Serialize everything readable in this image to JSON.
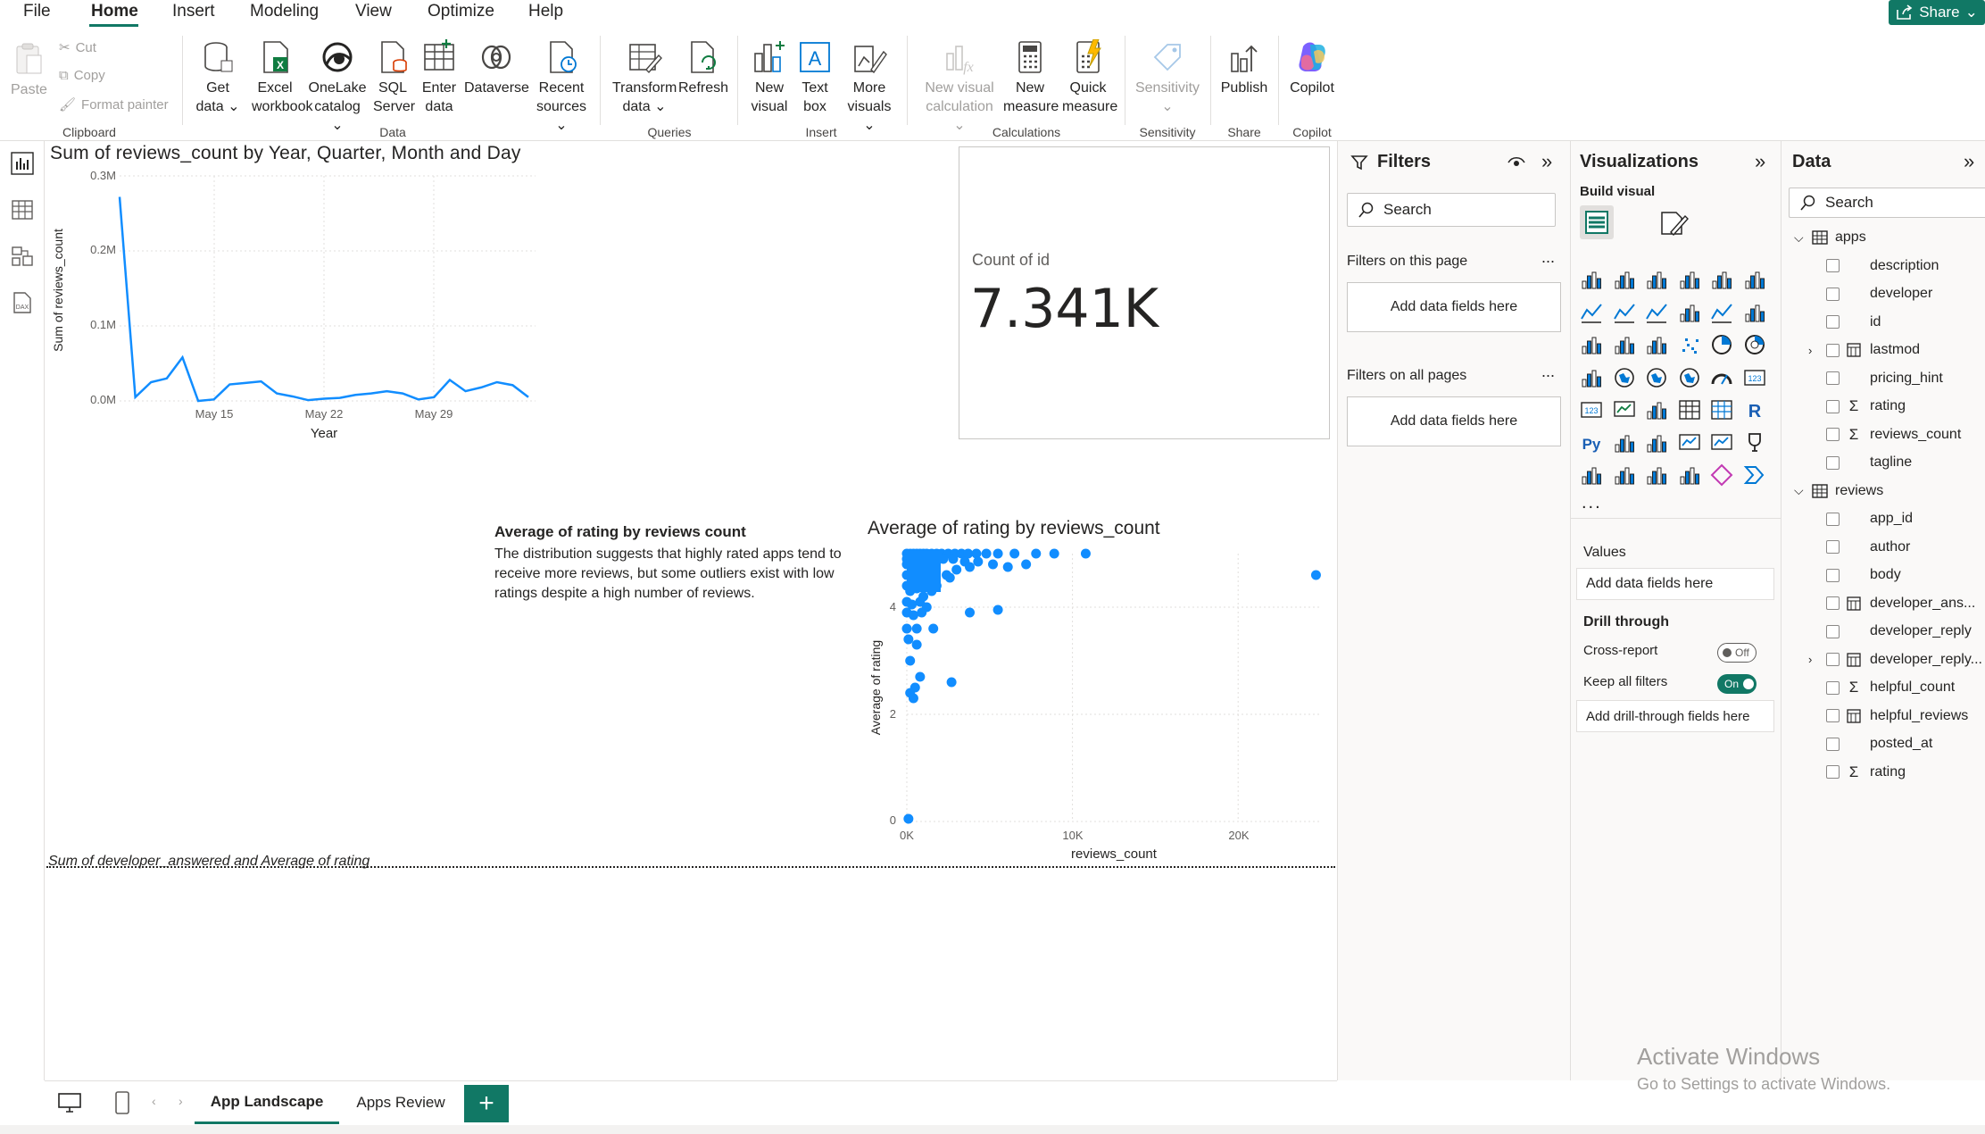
{
  "menu": {
    "items": [
      "File",
      "Home",
      "Insert",
      "Modeling",
      "View",
      "Optimize",
      "Help"
    ],
    "share_label": "Share"
  },
  "ribbon": {
    "clipboard": {
      "paste": "Paste",
      "cut": "Cut",
      "copy": "Copy",
      "format_painter": "Format painter",
      "group": "Clipboard"
    },
    "data": {
      "get_data": [
        "Get",
        "data ⌄"
      ],
      "excel": [
        "Excel",
        "workbook"
      ],
      "onelake": [
        "OneLake",
        "catalog ⌄"
      ],
      "sql": [
        "SQL",
        "Server"
      ],
      "enter": [
        "Enter",
        "data"
      ],
      "dataverse": [
        "Dataverse"
      ],
      "recent": [
        "Recent",
        "sources ⌄"
      ],
      "group": "Data"
    },
    "queries": {
      "transform": [
        "Transform",
        "data ⌄"
      ],
      "refresh": [
        "Refresh"
      ],
      "group": "Queries"
    },
    "insert": {
      "new_visual": [
        "New",
        "visual"
      ],
      "text_box": [
        "Text",
        "box"
      ],
      "more_visuals": [
        "More",
        "visuals ⌄"
      ],
      "group": "Insert"
    },
    "calculations": {
      "new_visual_calc": [
        "New visual",
        "calculation ⌄"
      ],
      "new_measure": [
        "New",
        "measure"
      ],
      "quick_measure": [
        "Quick",
        "measure"
      ],
      "group": "Calculations"
    },
    "sensitivity": {
      "label": [
        "Sensitivity",
        "⌄"
      ],
      "group": "Sensitivity"
    },
    "share": {
      "publish": [
        "Publish"
      ],
      "group": "Share"
    },
    "copilot": {
      "label": [
        "Copilot"
      ],
      "group": "Copilot"
    }
  },
  "line_chart": {
    "title": "Sum of reviews_count by Year, Quarter, Month and Day",
    "xlabel": "Year",
    "ylabel": "Sum of reviews_count",
    "yticks": [
      "0.3M",
      "0.2M",
      "0.1M",
      "0.0M"
    ],
    "xticks": [
      "May 15",
      "May 22",
      "May 29"
    ]
  },
  "card": {
    "label": "Count of id",
    "value": "7.341K"
  },
  "narrative": {
    "title": "Average of rating by reviews count",
    "body": "The distribution suggests that highly rated apps tend to receive more reviews, but some outliers exist with low ratings despite a high number of reviews."
  },
  "scatter_chart": {
    "title": "Average of rating by reviews_count",
    "xlabel": "reviews_count",
    "ylabel": "Average of rating",
    "yticks": [
      "4",
      "2",
      "0"
    ],
    "xticks": [
      "0K",
      "10K",
      "20K"
    ]
  },
  "bottom_visual": {
    "title": "Sum of developer_answered and Average of rating"
  },
  "pages": {
    "tabs": [
      "App Landscape",
      "Apps Review"
    ],
    "add": "+"
  },
  "filters": {
    "title": "Filters",
    "search_placeholder": "Search",
    "this_page": "Filters on this page",
    "all_pages": "Filters on all pages",
    "add_fields": "Add data fields here",
    "more": "..."
  },
  "visualizations": {
    "title": "Visualizations",
    "build_visual": "Build visual",
    "more": "...",
    "values_label": "Values",
    "values_placeholder": "Add data fields here",
    "drill_through": "Drill through",
    "cross_report": "Cross-report",
    "cross_report_state": "Off",
    "keep_filters": "Keep all filters",
    "keep_filters_state": "On",
    "drill_placeholder": "Add drill-through fields here"
  },
  "data_pane": {
    "title": "Data",
    "search_placeholder": "Search",
    "tables": [
      {
        "name": "apps",
        "fields": [
          {
            "name": "description",
            "kind": "text"
          },
          {
            "name": "developer",
            "kind": "text"
          },
          {
            "name": "id",
            "kind": "text"
          },
          {
            "name": "lastmod",
            "kind": "date"
          },
          {
            "name": "pricing_hint",
            "kind": "text"
          },
          {
            "name": "rating",
            "kind": "sum"
          },
          {
            "name": "reviews_count",
            "kind": "sum"
          },
          {
            "name": "tagline",
            "kind": "text"
          }
        ]
      },
      {
        "name": "reviews",
        "fields": [
          {
            "name": "app_id",
            "kind": "text"
          },
          {
            "name": "author",
            "kind": "text"
          },
          {
            "name": "body",
            "kind": "text"
          },
          {
            "name": "developer_ans...",
            "kind": "calc"
          },
          {
            "name": "developer_reply",
            "kind": "text"
          },
          {
            "name": "developer_reply...",
            "kind": "date"
          },
          {
            "name": "helpful_count",
            "kind": "sum"
          },
          {
            "name": "helpful_reviews",
            "kind": "calc"
          },
          {
            "name": "posted_at",
            "kind": "text"
          },
          {
            "name": "rating",
            "kind": "sum"
          }
        ]
      }
    ]
  },
  "watermark": {
    "title": "Activate Windows",
    "subtitle": "Go to Settings to activate Windows."
  },
  "colors": {
    "accent": "#117865",
    "series": "#118DFF"
  },
  "chart_data": [
    {
      "type": "line",
      "title": "Sum of reviews_count by Year, Quarter, Month and Day",
      "xlabel": "Year",
      "ylabel": "Sum of reviews_count",
      "ylim": [
        0,
        300000
      ],
      "x": [
        "May 9",
        "May 10",
        "May 11",
        "May 12",
        "May 13",
        "May 14",
        "May 15",
        "May 16",
        "May 17",
        "May 18",
        "May 19",
        "May 20",
        "May 21",
        "May 22",
        "May 23",
        "May 24",
        "May 25",
        "May 26",
        "May 27",
        "May 28",
        "May 29",
        "May 30",
        "May 31",
        "Jun 1",
        "Jun 2",
        "Jun 3",
        "Jun 4"
      ],
      "series": [
        {
          "values": [
            272000,
            5000,
            25000,
            30000,
            58000,
            0,
            2000,
            22000,
            24000,
            26000,
            10000,
            6000,
            1000,
            3000,
            4000,
            8000,
            10000,
            13000,
            10000,
            2000,
            5000,
            28000,
            13000,
            18000,
            25000,
            21000,
            5000
          ]
        }
      ],
      "grid": true
    },
    {
      "type": "scatter",
      "title": "Average of rating by reviews_count",
      "xlabel": "reviews_count",
      "ylabel": "Average of rating",
      "xlim": [
        0,
        25000
      ],
      "ylim": [
        0,
        5
      ],
      "points": [
        [
          0,
          5
        ],
        [
          200,
          5
        ],
        [
          400,
          5
        ],
        [
          600,
          5
        ],
        [
          800,
          5
        ],
        [
          1000,
          5
        ],
        [
          1200,
          5
        ],
        [
          1500,
          5
        ],
        [
          1800,
          5
        ],
        [
          2100,
          5
        ],
        [
          2500,
          5
        ],
        [
          2900,
          5
        ],
        [
          3300,
          5
        ],
        [
          3700,
          5
        ],
        [
          4200,
          5
        ],
        [
          4800,
          5
        ],
        [
          5500,
          5
        ],
        [
          6500,
          5
        ],
        [
          7800,
          5
        ],
        [
          8900,
          5
        ],
        [
          10800,
          5
        ],
        [
          24700,
          4.6
        ],
        [
          0,
          4.9
        ],
        [
          300,
          4.9
        ],
        [
          700,
          4.9
        ],
        [
          1100,
          4.9
        ],
        [
          1600,
          4.9
        ],
        [
          2200,
          4.9
        ],
        [
          2800,
          4.9
        ],
        [
          3500,
          4.85
        ],
        [
          4300,
          4.85
        ],
        [
          5200,
          4.8
        ],
        [
          6100,
          4.75
        ],
        [
          7200,
          4.8
        ],
        [
          0,
          4.8
        ],
        [
          250,
          4.8
        ],
        [
          600,
          4.7
        ],
        [
          900,
          4.7
        ],
        [
          1300,
          4.7
        ],
        [
          1700,
          4.6
        ],
        [
          2400,
          4.6
        ],
        [
          3000,
          4.7
        ],
        [
          3800,
          4.75
        ],
        [
          0,
          4.6
        ],
        [
          300,
          4.5
        ],
        [
          700,
          4.5
        ],
        [
          1200,
          4.5
        ],
        [
          1800,
          4.4
        ],
        [
          2600,
          4.55
        ],
        [
          0,
          4.4
        ],
        [
          200,
          4.3
        ],
        [
          600,
          4.35
        ],
        [
          1000,
          4.2
        ],
        [
          1500,
          4.3
        ],
        [
          0,
          4.1
        ],
        [
          300,
          4.05
        ],
        [
          800,
          4.1
        ],
        [
          1200,
          4.0
        ],
        [
          0,
          3.9
        ],
        [
          400,
          3.85
        ],
        [
          900,
          3.9
        ],
        [
          3800,
          3.9
        ],
        [
          5500,
          3.95
        ],
        [
          0,
          3.6
        ],
        [
          600,
          3.6
        ],
        [
          1600,
          3.6
        ],
        [
          100,
          3.4
        ],
        [
          600,
          3.3
        ],
        [
          200,
          3.0
        ],
        [
          2700,
          2.6
        ],
        [
          500,
          2.5
        ],
        [
          800,
          2.7
        ],
        [
          200,
          2.4
        ],
        [
          400,
          2.3
        ],
        [
          100,
          0.05
        ]
      ]
    }
  ]
}
